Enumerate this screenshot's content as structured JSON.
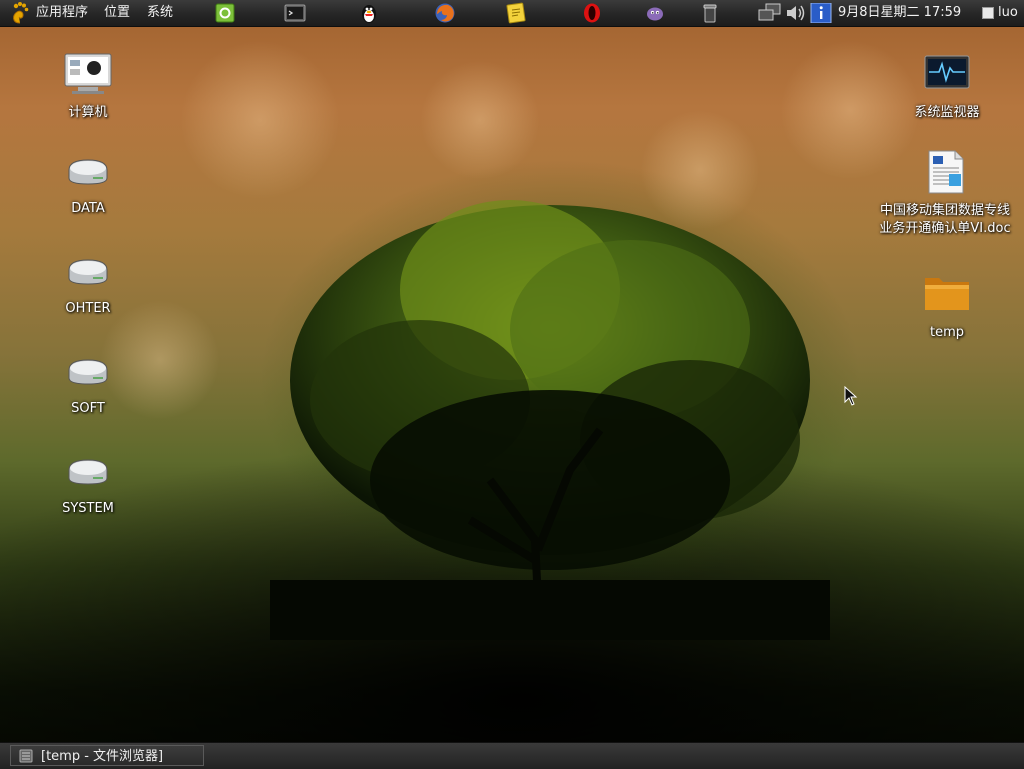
{
  "top_panel": {
    "menus": [
      "应用程序",
      "位置",
      "系统"
    ],
    "launchers": [
      "gpk-icon",
      "terminal-icon",
      "qq-penguin-icon",
      "firefox-icon",
      "notes-icon",
      "opera-icon",
      "pidgin-icon",
      "trash-icon"
    ],
    "tray": [
      "network-icon",
      "volume-icon",
      "info-icon"
    ],
    "clock": "9月8日星期二 17:59",
    "user": "luo"
  },
  "desktop_icons_left": [
    {
      "label": "计算机",
      "icon": "computer-icon"
    },
    {
      "label": "DATA",
      "icon": "drive-icon"
    },
    {
      "label": "OHTER",
      "icon": "drive-icon"
    },
    {
      "label": "SOFT",
      "icon": "drive-icon"
    },
    {
      "label": "SYSTEM",
      "icon": "drive-icon"
    }
  ],
  "desktop_icons_right": [
    {
      "label": "系统监视器",
      "icon": "system-monitor-icon"
    },
    {
      "label_line1": "中国移动集团数据专线",
      "label_line2": "业务开通确认单VI.doc",
      "icon": "document-icon"
    },
    {
      "label": "temp",
      "icon": "folder-icon"
    }
  ],
  "taskbar": {
    "window_label": "[temp - 文件浏览器]"
  },
  "colors": {
    "panel_bg": "#262626",
    "panel_text": "#f2f2f2",
    "folder": "#e3951c"
  }
}
